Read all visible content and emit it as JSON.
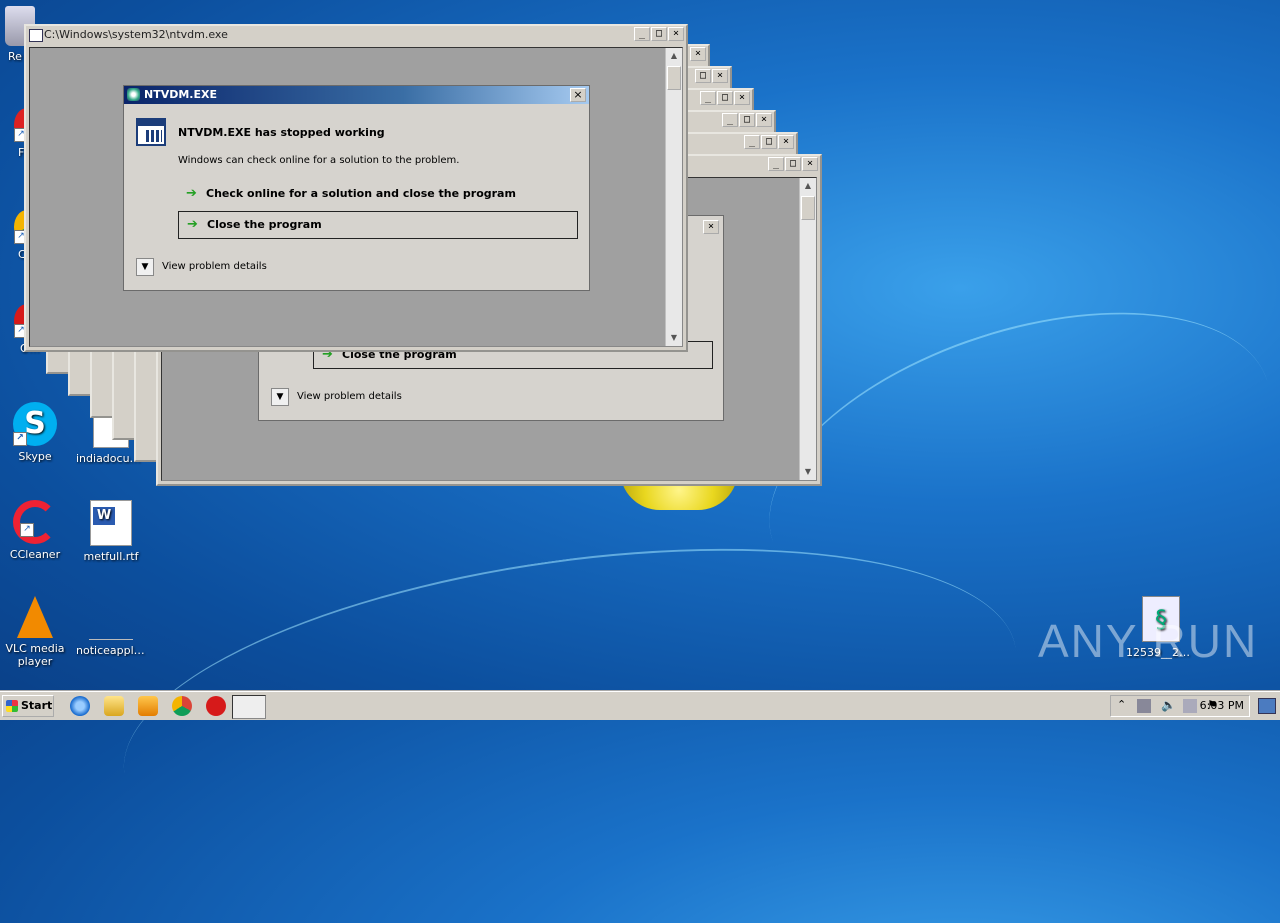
{
  "desktop": {
    "icons": [
      {
        "label": "Re"
      },
      {
        "label": "F"
      },
      {
        "label": "C"
      },
      {
        "label": "Oper"
      },
      {
        "label": "Skype"
      },
      {
        "label": "indiadocum..."
      },
      {
        "label": "CCleaner"
      },
      {
        "label": "metfull.rtf"
      },
      {
        "label": "VLC media player"
      },
      {
        "label": "noticeapplic..."
      },
      {
        "label": "12539__25..."
      }
    ],
    "watermark": "ANY RUN"
  },
  "console_window": {
    "title": "C:\\Windows\\system32\\ntvdm.exe",
    "buttons": [
      "_",
      "□",
      "×"
    ]
  },
  "dialog": {
    "title": "NTVDM.EXE",
    "heading": "NTVDM.EXE has stopped working",
    "subtext": "Windows can check online for a solution to the problem.",
    "action_check": "Check online for a solution and close the program",
    "action_close": "Close the program",
    "details": "View problem details",
    "close_glyph": "×"
  },
  "background_dialog": {
    "action_close": "Close the program",
    "details": "View problem details"
  },
  "taskbar": {
    "start_label": "Start",
    "clock": "6:03 PM",
    "pinned": [
      "internet-explorer",
      "explorer",
      "media-player",
      "chrome",
      "opera",
      "ntvdm"
    ]
  },
  "colors": {
    "desktop": "#1a72c9",
    "title_active": "#0a246a",
    "window_face": "#d4d0c8",
    "client_grey": "#a0a0a0"
  }
}
